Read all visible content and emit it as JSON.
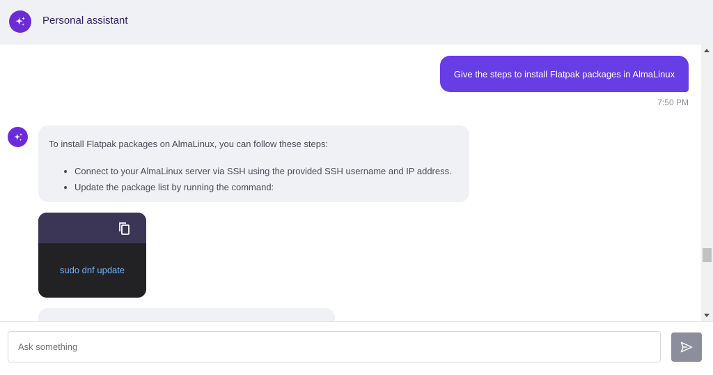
{
  "header": {
    "title": "Personal assistant",
    "icon": "sparkles-icon"
  },
  "messages": {
    "user": {
      "text": "Give the steps to install Flatpak packages in AlmaLinux",
      "time": "7:50 PM"
    },
    "bot": {
      "intro": "To install Flatpak packages on AlmaLinux, you can follow these steps:",
      "steps": [
        "Connect to your AlmaLinux server via SSH using the provided SSH username and IP address.",
        "Update the package list by running the command:"
      ]
    },
    "code": {
      "text": "sudo dnf update",
      "copy_icon": "copy-icon"
    }
  },
  "composer": {
    "placeholder": "Ask something",
    "send_icon": "send-icon"
  },
  "colors": {
    "accent": "#673de6",
    "avatar": "#6c2bd9",
    "code_bg": "#222224",
    "code_header": "#3b3656",
    "code_text": "#6fb5ff"
  }
}
